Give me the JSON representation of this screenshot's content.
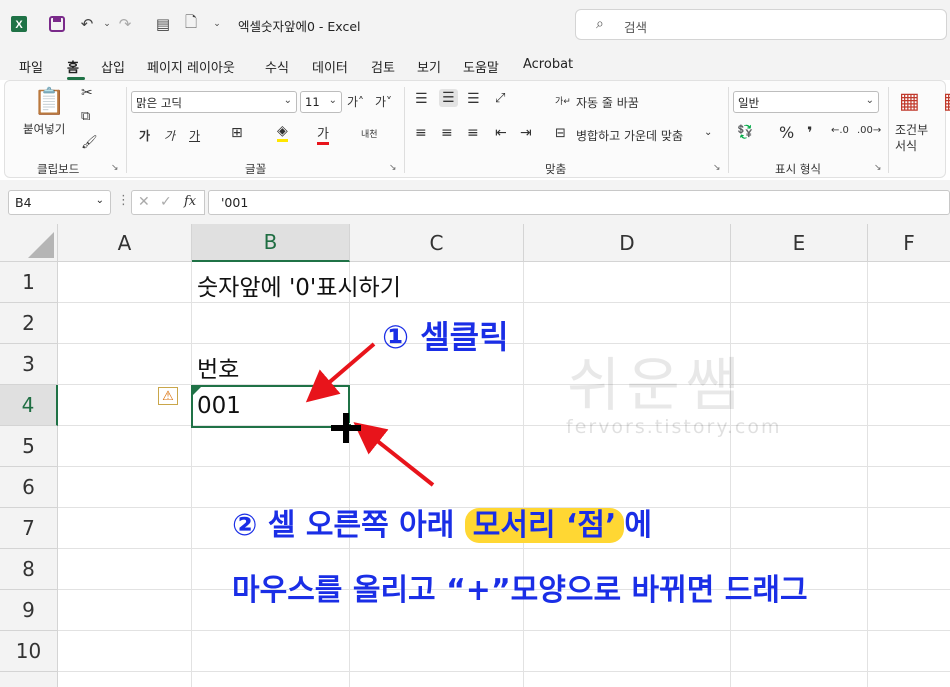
{
  "titlebar": {
    "title": "엑셀숫자앞에0 - Excel",
    "search_placeholder": "검색"
  },
  "tabs": [
    "파일",
    "홈",
    "삽입",
    "페이지 레이아웃",
    "수식",
    "데이터",
    "검토",
    "보기",
    "도움말",
    "Acrobat"
  ],
  "ribbon": {
    "clipboard": {
      "paste": "붙여넣기",
      "label": "클립보드"
    },
    "font": {
      "family": "맑은 고딕",
      "size": "11",
      "bold": "가",
      "italic": "가",
      "underline": "가",
      "label": "글꼴"
    },
    "align": {
      "wrap": "자동 줄 바꿈",
      "merge": "병합하고 가운데 맞춤",
      "label": "맞춤"
    },
    "number": {
      "format": "일반",
      "percent": "%",
      "comma": "❜",
      "label": "표시 형식"
    },
    "styles": {
      "cond1": "조건부",
      "cond2": "서식"
    }
  },
  "formula_bar": {
    "name_box": "B4",
    "fx": "fx",
    "content": "'001"
  },
  "columns": [
    "A",
    "B",
    "C",
    "D",
    "E",
    "F"
  ],
  "rows": [
    "1",
    "2",
    "3",
    "4",
    "5",
    "6",
    "7",
    "8",
    "9",
    "10"
  ],
  "cells": {
    "B1": "숫자앞에 '0'표시하기",
    "B3": "번호",
    "B4": "001"
  },
  "annotations": {
    "step1": "① 셀클릭",
    "step2_pre": "② 셀 오른쪽 아래 ",
    "step2_hl": "모서리 ‘점’",
    "step2_post": "에",
    "step3": "마우스를 올리고 “+”모양으로 바뀌면 드래그"
  },
  "watermark": {
    "text": "쉬운쌤",
    "url": "fervors.tistory.com"
  },
  "colors": {
    "excel_green": "#1f7246",
    "annotation_blue": "#1a2ee6",
    "highlight": "#ffd733",
    "arrow_red": "#e8141b"
  }
}
